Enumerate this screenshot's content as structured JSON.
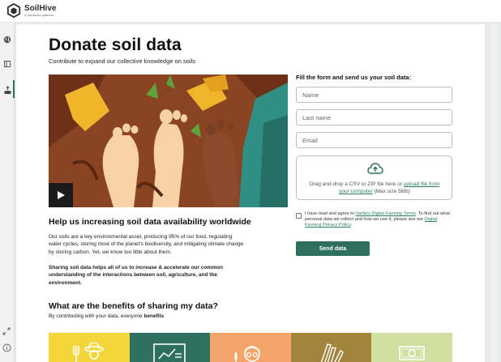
{
  "app": {
    "brand_name": "SoilHive",
    "brand_tagline": "A Varda-led platform",
    "accent_color": "#2f6f5e"
  },
  "sidebar": {
    "items": [
      {
        "icon": "globe-icon"
      },
      {
        "icon": "book-icon"
      },
      {
        "icon": "upload-soil-icon",
        "active": true
      }
    ],
    "bottom_items": [
      {
        "icon": "collapse-arrows-icon"
      },
      {
        "icon": "info-icon"
      }
    ]
  },
  "page": {
    "title": "Donate soil data",
    "subtitle": "Contribute to expand our collective knowledge on soils"
  },
  "video": {
    "play_icon": "play-icon"
  },
  "content": {
    "heading": "Help us increasing soil data availability worldwide",
    "paragraph1": "Our soils are a key environmental asset, producing 95% of our food, regulating water cycles, storing most of the planet's biodiversity, and mitigating climate change by storing carbon. Yet, we know too little about them.",
    "paragraph2": "Sharing soil data helps all of us to increase & accelerate our common understanding of the interactions between soil, agriculture, and the environment.",
    "benefits_heading": "What are the benefits of sharing my data?",
    "benefits_sub_prefix": "By contributing with your data, everyone",
    "benefits_sub_bold": "benefits"
  },
  "form": {
    "title": "Fill the form and send us your soil data:",
    "name_placeholder": "Name",
    "lastname_placeholder": "Last name",
    "email_placeholder": "Email",
    "upload_text": "Drag and drop a CSV or ZIP file here or",
    "upload_link": "upload file from your computer",
    "upload_max": "(Max size 5Mb)",
    "agree_prefix": "I have read and agree to",
    "agree_terms_link": "Varda's Digital Farming Terms",
    "agree_middle": ". To find out what personal data we collect and how we use it, please see our",
    "agree_privacy_link": "Digital Farming Privacy Policy",
    "agree_suffix": ".",
    "send_label": "Send data"
  },
  "benefit_cards": [
    {
      "icon": "farmer-icon",
      "color": "#f5d63a"
    },
    {
      "icon": "presentation-board-icon",
      "color": "#2f6f5e"
    },
    {
      "icon": "scientist-icon",
      "color": "#f4a56a"
    },
    {
      "icon": "books-icon",
      "color": "#a3843c"
    },
    {
      "icon": "money-icon",
      "color": "#cfe0a0"
    }
  ]
}
